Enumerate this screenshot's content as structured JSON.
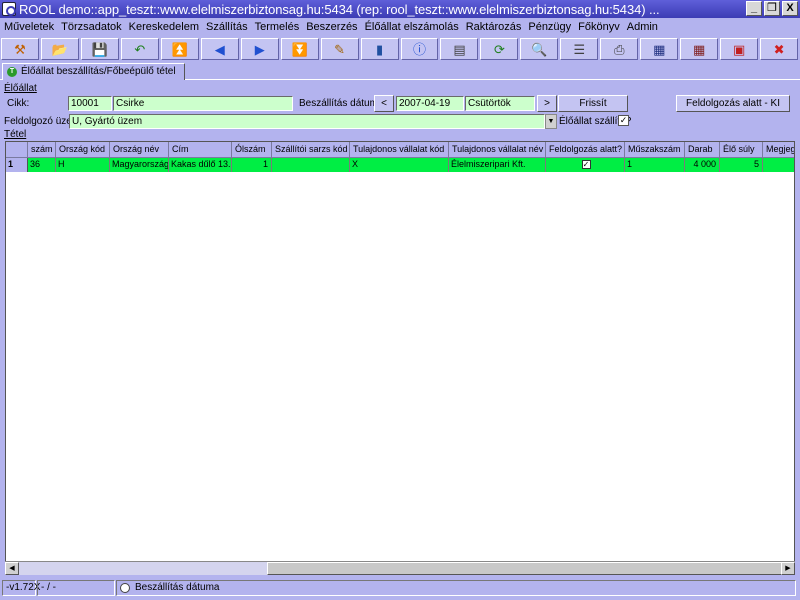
{
  "window": {
    "title": "ROOL demo::app_teszt::www.elelmiszerbiztonsag.hu:5434 (rep: rool_teszt::www.elelmiszerbiztonsag.hu:5434) ...",
    "minimize": "_",
    "restore": "❐",
    "close": "X"
  },
  "menu": [
    "Műveletek",
    "Törzsadatok",
    "Kereskedelem",
    "Szállítás",
    "Termelés",
    "Beszerzés",
    "Élőállat elszámolás",
    "Raktározás",
    "Pénzügy",
    "Főkönyv",
    "Admin"
  ],
  "toolbar": [
    {
      "name": "tool-icon",
      "glyph": "⚒",
      "color": "#c06000"
    },
    {
      "name": "open-folder-icon",
      "glyph": "📂",
      "color": "#2050c0"
    },
    {
      "name": "save-icon",
      "glyph": "💾",
      "color": "#203080"
    },
    {
      "name": "undo-icon",
      "glyph": "↶",
      "color": "#208020"
    },
    {
      "name": "first-record-icon",
      "glyph": "⏫",
      "color": "#2050d0"
    },
    {
      "name": "previous-record-icon",
      "glyph": "◀",
      "color": "#2050d0"
    },
    {
      "name": "next-record-icon",
      "glyph": "▶",
      "color": "#2050d0"
    },
    {
      "name": "last-record-icon",
      "glyph": "⏬",
      "color": "#2050d0"
    },
    {
      "name": "edit-icon",
      "glyph": "✎",
      "color": "#a06000"
    },
    {
      "name": "database-icon",
      "glyph": "▮",
      "color": "#2050a0"
    },
    {
      "name": "info-icon",
      "glyph": "ⓘ",
      "color": "#2050d0"
    },
    {
      "name": "form-view-icon",
      "glyph": "▤",
      "color": "#404040"
    },
    {
      "name": "refresh-icon",
      "glyph": "⟳",
      "color": "#208020"
    },
    {
      "name": "search-icon",
      "glyph": "🔍",
      "color": "#404040"
    },
    {
      "name": "list-icon",
      "glyph": "☰",
      "color": "#404040"
    },
    {
      "name": "print-icon",
      "glyph": "⎙",
      "color": "#404040"
    },
    {
      "name": "grid-view-icon",
      "glyph": "▦",
      "color": "#203080"
    },
    {
      "name": "grid-edit-icon",
      "glyph": "▦",
      "color": "#802020"
    },
    {
      "name": "window-icon",
      "glyph": "▣",
      "color": "#c02020"
    },
    {
      "name": "exit-icon",
      "glyph": "✖",
      "color": "#d02020"
    }
  ],
  "tab": {
    "label": "Élőállat beszállítás/Főbeépülő tétel"
  },
  "header_section": {
    "label": "Élőállat"
  },
  "form": {
    "cikk_label": "Cikk:",
    "cikk_code": "10001",
    "cikk_name": "Csirke",
    "date_label": "Beszállítás dátuma:",
    "prev_label": "<",
    "date_value": "2007-04-19",
    "weekday": "Csütörtök",
    "next_label": ">",
    "refresh_label": "Frissít",
    "feldolgozas_button": "Feldolgozás alatt - KI",
    "plant_label": "Feldolgozó üzem:",
    "plant_value": "U, Gyártó üzem",
    "shipped_label": "Élőállat szállító?",
    "shipped_checked": "✓"
  },
  "items_section": {
    "label": "Tétel"
  },
  "grid": {
    "columns": [
      "",
      "szám",
      "Ország kód",
      "Ország név",
      "Cím",
      "Ólszám",
      "Szállítói sarzs kód",
      "Tulajdonos vállalat kód",
      "Tulajdonos vállalat név",
      "Feldolgozás alatt?",
      "Műszakszám",
      "Darab",
      "Élő súly",
      "Megjeg"
    ],
    "row": {
      "rownum": "1",
      "szam": "36",
      "country_code": "H",
      "country_name": "Magyarország",
      "address": "Kakas dűlő 13.",
      "olszam": "1",
      "supplier_batch": "",
      "owner_code": "X",
      "owner_name": "Élelmiszeripari Kft.",
      "processing_checked": "✓",
      "shift": "1",
      "darab": "4 000",
      "weight": "5",
      "note": ""
    }
  },
  "scrollbar": {
    "left": "◀",
    "right": "▶"
  },
  "status": {
    "version": "-v1.72X",
    "record": "- / -",
    "option_label": "Beszállítás dátuma"
  }
}
